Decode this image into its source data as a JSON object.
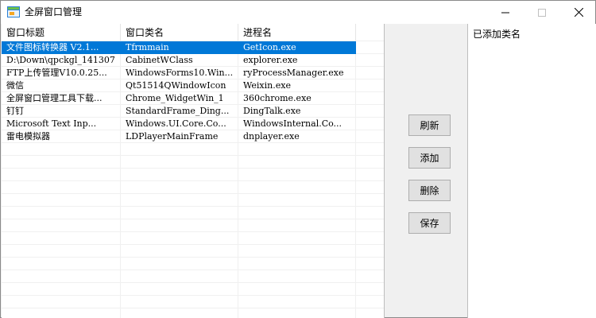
{
  "window": {
    "title": "全屏窗口管理",
    "controls": {
      "minimize": "—",
      "maximize": "☐",
      "close": "✕"
    }
  },
  "main_list": {
    "columns": [
      "窗口标题",
      "窗口类名",
      "进程名"
    ],
    "rows": [
      [
        "文件图标转换器 V2.1...",
        "Tfrmmain",
        "GetIcon.exe"
      ],
      [
        "D:\\Down\\qpckgl_141307",
        "CabinetWClass",
        "explorer.exe"
      ],
      [
        "FTP上传管理V10.0.25...",
        "WindowsForms10.Win...",
        "ryProcessManager.exe"
      ],
      [
        "微信",
        "Qt51514QWindowIcon",
        "Weixin.exe"
      ],
      [
        "全屏窗口管理工具下载...",
        "Chrome_WidgetWin_1",
        "360chrome.exe"
      ],
      [
        "钉钉",
        "StandardFrame_Ding...",
        "DingTalk.exe"
      ],
      [
        "Microsoft Text Inp...",
        "Windows.UI.Core.Co...",
        "WindowsInternal.Co..."
      ],
      [
        "雷电模拟器",
        "LDPlayerMainFrame",
        "dnplayer.exe"
      ]
    ],
    "selected_row": 0
  },
  "buttons": {
    "refresh": "刷新",
    "add": "添加",
    "delete": "删除",
    "save": "保存"
  },
  "right_list": {
    "header": "已添加类名"
  },
  "colors": {
    "selection": "#0078d7",
    "button_face": "#e1e1e1",
    "window_bg": "#f0f0f0"
  }
}
